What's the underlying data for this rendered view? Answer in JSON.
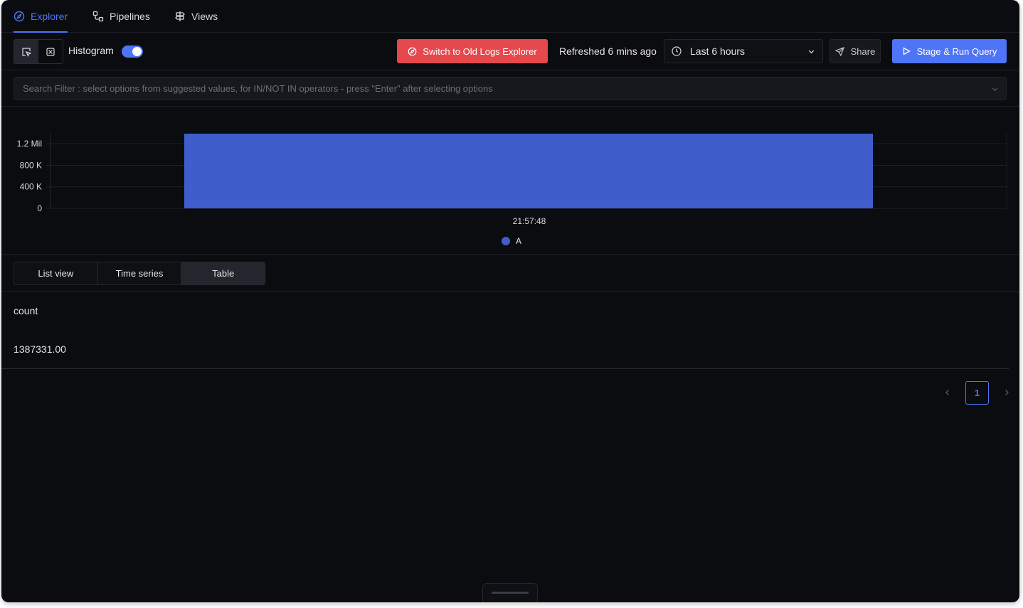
{
  "nav": {
    "tabs": [
      {
        "label": "Explorer",
        "icon": "compass-icon",
        "active": true
      },
      {
        "label": "Pipelines",
        "icon": "pipeline-icon",
        "active": false
      },
      {
        "label": "Views",
        "icon": "signpost-icon",
        "active": false
      }
    ]
  },
  "toolbar": {
    "histogram_label": "Histogram",
    "histogram_on": true,
    "old_explorer_label": "Switch to Old Logs Explorer",
    "refreshed_text": "Refreshed 6 mins ago",
    "time_range": "Last 6 hours",
    "share_label": "Share",
    "run_label": "Stage & Run Query"
  },
  "search": {
    "placeholder": "Search Filter : select options from suggested values, for IN/NOT IN operators - press \"Enter\" after selecting options"
  },
  "chart_data": {
    "type": "bar",
    "categories": [
      "21:57:48"
    ],
    "series": [
      {
        "name": "A",
        "values": [
          1387331
        ],
        "color": "#3f5ecc"
      }
    ],
    "yticks": [
      {
        "value": 0,
        "label": "0"
      },
      {
        "value": 400000,
        "label": "400 K"
      },
      {
        "value": 800000,
        "label": "800 K"
      },
      {
        "value": 1200000,
        "label": "1.2 Mil"
      }
    ],
    "ylim": [
      0,
      1387331
    ],
    "grid": true,
    "legend": "bottom-center"
  },
  "view_tabs": [
    {
      "label": "List view",
      "active": false
    },
    {
      "label": "Time series",
      "active": false
    },
    {
      "label": "Table",
      "active": true
    }
  ],
  "table": {
    "columns": [
      "count"
    ],
    "rows": [
      [
        "1387331.00"
      ]
    ]
  },
  "pagination": {
    "current_page": "1"
  },
  "colors": {
    "accent": "#4e74f8",
    "danger": "#e5484d",
    "background": "#0b0c0f"
  }
}
